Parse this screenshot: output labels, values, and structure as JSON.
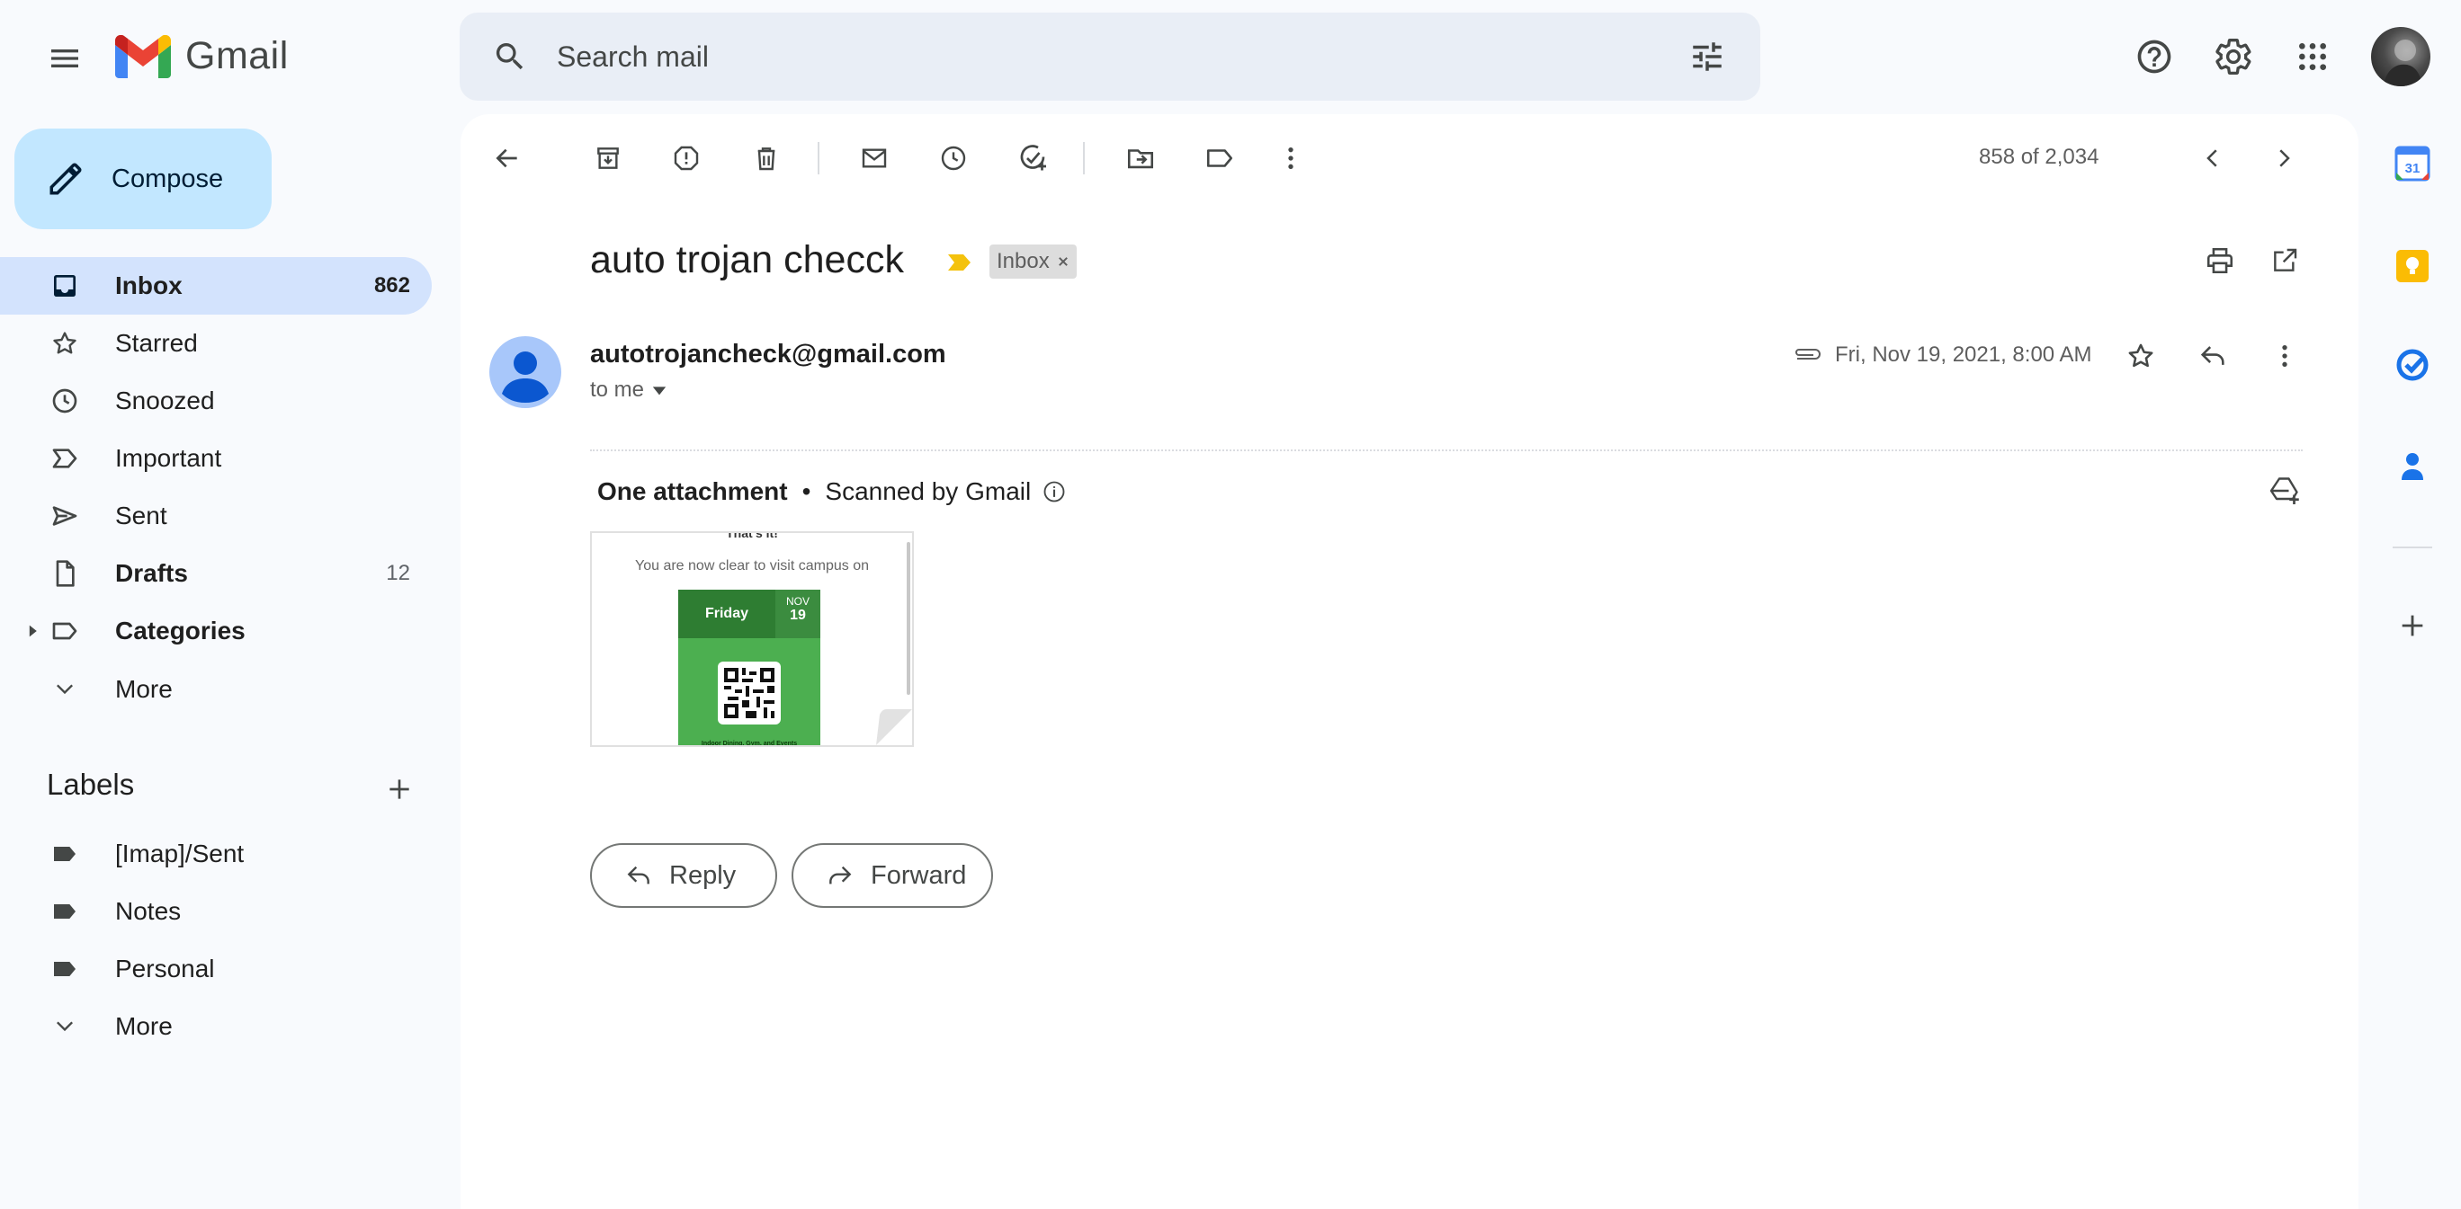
{
  "app": {
    "name": "Gmail"
  },
  "icons": {
    "menu": "menu-icon",
    "search": "search-icon",
    "tune": "tune-icon",
    "help": "help-icon",
    "settings": "gear-icon",
    "apps": "apps-grid-icon"
  },
  "colors": {
    "accent": "#0b57d0",
    "compose_bg": "#c2e7ff",
    "active_nav_bg": "#d3e3fd",
    "important_marker": "#f4c20d"
  },
  "search": {
    "placeholder": "Search mail"
  },
  "sidebar": {
    "compose_label": "Compose",
    "items": [
      {
        "label": "Inbox",
        "count": "862",
        "icon": "inbox-icon",
        "active": true
      },
      {
        "label": "Starred",
        "count": "",
        "icon": "star-icon"
      },
      {
        "label": "Snoozed",
        "count": "",
        "icon": "clock-icon"
      },
      {
        "label": "Important",
        "count": "",
        "icon": "important-icon"
      },
      {
        "label": "Sent",
        "count": "",
        "icon": "send-icon"
      },
      {
        "label": "Drafts",
        "count": "12",
        "icon": "draft-icon"
      },
      {
        "label": "Categories",
        "count": "",
        "icon": "label-icon"
      },
      {
        "label": "More",
        "count": "",
        "icon": "chevron-down-icon"
      }
    ],
    "labels_heading": "Labels",
    "labels": [
      {
        "label": "[Imap]/Sent"
      },
      {
        "label": "Notes"
      },
      {
        "label": "Personal"
      }
    ],
    "labels_more": "More"
  },
  "toolbar": {
    "pagination": "858 of 2,034"
  },
  "email": {
    "subject": "auto trojan checck",
    "inbox_chip": "Inbox",
    "sender": "autotrojancheck@gmail.com",
    "to": "to me",
    "date": "Fri, Nov 19, 2021, 8:00 AM",
    "attachments_heading": "One attachment",
    "separator": "•",
    "scanned": "Scanned by Gmail",
    "attachment_preview": {
      "top_text": "That's it!",
      "line": "You are now clear to visit campus on",
      "day": "Friday",
      "month": "NOV",
      "date": "19",
      "footer": "Indoor Dining, Gym, and Events"
    }
  },
  "actions": {
    "reply": "Reply",
    "forward": "Forward"
  },
  "rail": {
    "calendar_day": "31"
  }
}
